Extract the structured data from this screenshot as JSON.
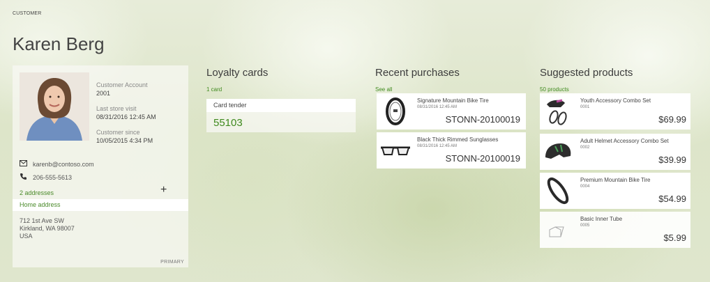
{
  "header": {
    "breadcrumb": "CUSTOMER",
    "name": "Karen Berg"
  },
  "customer": {
    "account_label": "Customer Account",
    "account_value": "2001",
    "last_visit_label": "Last store visit",
    "last_visit_value": "08/31/2016 12:45 AM",
    "since_label": "Customer since",
    "since_value": "10/05/2015 4:34 PM",
    "email": "karenb@contoso.com",
    "phone": "206-555-5613",
    "address_count": "2 addresses",
    "add_label": "+",
    "address_name": "Home address",
    "address_line1": "712 1st Ave SW",
    "address_line2": "Kirkland, WA 98007",
    "address_line3": "USA",
    "primary_label": "PRIMARY"
  },
  "loyalty": {
    "title": "Loyalty cards",
    "count": "1 card",
    "card_label": "Card tender",
    "card_number": "55103"
  },
  "purchases": {
    "title": "Recent purchases",
    "see_all": "See all",
    "items": [
      {
        "name": "Signature Mountain Bike Tire",
        "date": "08/31/2016 12:45 AM",
        "id": "STONN-20100019"
      },
      {
        "name": "Black Thick Rimmed Sunglasses",
        "date": "08/31/2016 12:45 AM",
        "id": "STONN-20100019"
      }
    ]
  },
  "suggested": {
    "title": "Suggested products",
    "count": "50 products",
    "items": [
      {
        "name": "Youth Accessory Combo Set",
        "code": "0001",
        "price": "$69.99"
      },
      {
        "name": "Adult Helmet Accessory Combo Set",
        "code": "0002",
        "price": "$39.99"
      },
      {
        "name": "Premium Mountain Bike Tire",
        "code": "0004",
        "price": "$54.99"
      },
      {
        "name": "Basic Inner Tube",
        "code": "0005",
        "price": "$5.99"
      }
    ]
  },
  "colors": {
    "accent_green": "#3f8a1e",
    "card_bg": "#ffffff"
  }
}
